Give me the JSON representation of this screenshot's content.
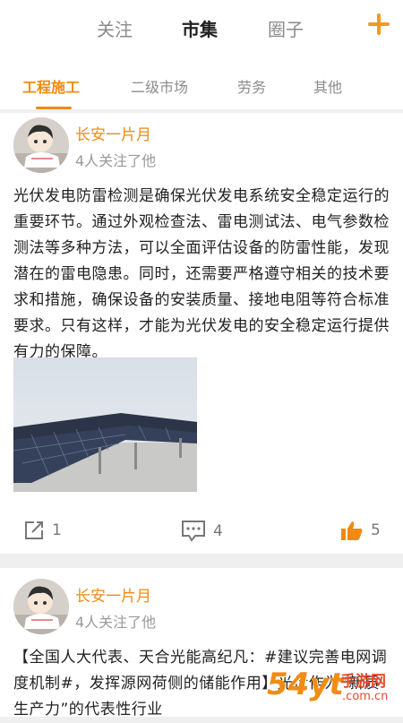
{
  "top_tabs": [
    "关注",
    "市集",
    "圈子"
  ],
  "sub_tabs": [
    "工程施工",
    "二级市场",
    "劳务",
    "其他"
  ],
  "posts": [
    {
      "username": "长安一片月",
      "followers": "4人关注了他",
      "text": "光伏发电防雷检测是确保光伏发电系统安全稳定运行的重要环节。通过外观检查法、雷电测试法、电气参数检测法等多种方法，可以全面评估设备的防雷性能，发现潜在的雷电隐患。同时，还需要严格遵守相关的技术要求和措施，确保设备的安装质量、接地电阻等符合标准要求。只有这样，才能为光伏发电的安全稳定运行提供有力的保障。",
      "share_count": "1",
      "comment_count": "4",
      "like_count": "5"
    },
    {
      "username": "长安一片月",
      "followers": "4人关注了他",
      "text": "【全国人大代表、天合光能高纪凡：#建议完善电网调度机制#，发挥源网荷侧的储能作用】光伏作为“新质生产力”的代表性行业"
    }
  ],
  "watermark": {
    "main": "54yt",
    "sub": "手游网",
    "site": ".com.cn"
  },
  "colors": {
    "accent": "#f08a12",
    "plus": "#f49a1f"
  },
  "icons": [
    "plus-icon",
    "share-icon",
    "comment-icon",
    "thumbs-up-icon"
  ]
}
